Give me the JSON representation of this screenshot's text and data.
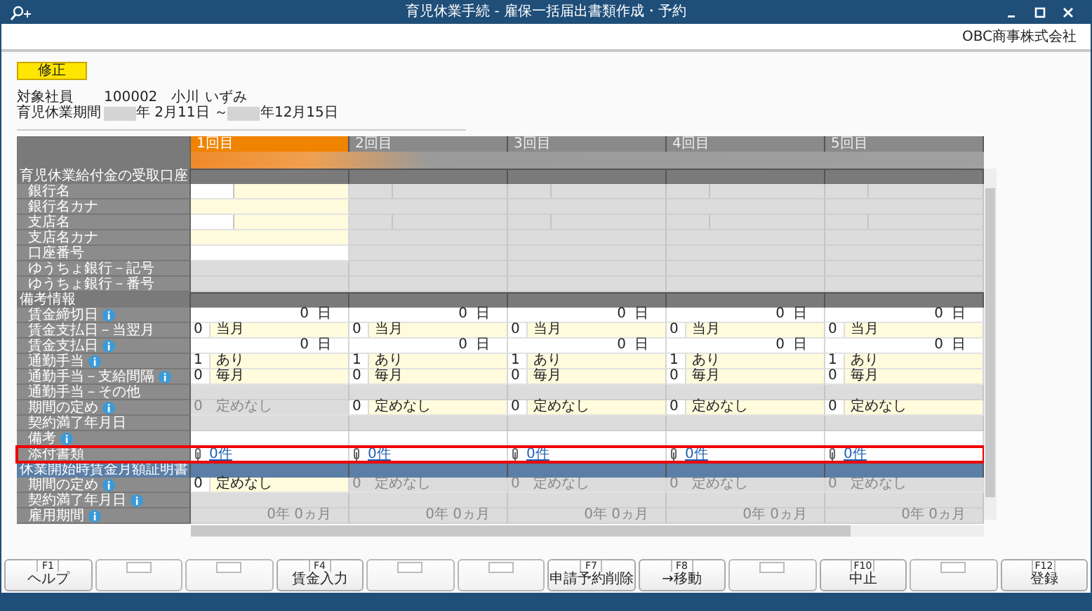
{
  "window": {
    "title": "育児休業手続 - 雇保一括届出書類作成・予約",
    "company": "OBC商事株式会社"
  },
  "mode_badge": "修正",
  "employee": {
    "label": "対象社員",
    "code": "100002",
    "family_name": "小川",
    "given_name": "いずみ"
  },
  "leave_period": {
    "label": "育児休業期間",
    "start": "年 2月11日 ～",
    "end": "年12月15日"
  },
  "columns": [
    {
      "label": "1回目",
      "selected": true
    },
    {
      "label": "2回目",
      "selected": false
    },
    {
      "label": "3回目",
      "selected": false
    },
    {
      "label": "4回目",
      "selected": false
    },
    {
      "label": "5回目",
      "selected": false
    }
  ],
  "rows": [
    {
      "kind": "section",
      "label": "育児休業給付金の受取口座",
      "color": "#7a7a7a"
    },
    {
      "kind": "field",
      "label": "銀行名",
      "info": false,
      "highlighted": false,
      "cells": [
        {
          "kind": "split",
          "locked": false
        },
        {
          "kind": "split",
          "locked": true
        },
        {
          "kind": "split",
          "locked": true
        },
        {
          "kind": "split",
          "locked": true
        },
        {
          "kind": "split",
          "locked": true
        }
      ]
    },
    {
      "kind": "field",
      "label": "銀行名カナ",
      "info": false,
      "highlighted": false,
      "cells": [
        {
          "kind": "blank",
          "locked": false,
          "selectable": true
        },
        {
          "kind": "blank",
          "locked": true,
          "selectable": false
        },
        {
          "kind": "blank",
          "locked": true,
          "selectable": false
        },
        {
          "kind": "blank",
          "locked": true,
          "selectable": false
        },
        {
          "kind": "blank",
          "locked": true,
          "selectable": false
        }
      ]
    },
    {
      "kind": "field",
      "label": "支店名",
      "info": false,
      "highlighted": false,
      "cells": [
        {
          "kind": "split",
          "locked": false
        },
        {
          "kind": "split",
          "locked": true
        },
        {
          "kind": "split",
          "locked": true
        },
        {
          "kind": "split",
          "locked": true
        },
        {
          "kind": "split",
          "locked": true
        }
      ]
    },
    {
      "kind": "field",
      "label": "支店名カナ",
      "info": false,
      "highlighted": false,
      "cells": [
        {
          "kind": "blank",
          "locked": false,
          "selectable": true
        },
        {
          "kind": "blank",
          "locked": true,
          "selectable": false
        },
        {
          "kind": "blank",
          "locked": true,
          "selectable": false
        },
        {
          "kind": "blank",
          "locked": true,
          "selectable": false
        },
        {
          "kind": "blank",
          "locked": true,
          "selectable": false
        }
      ]
    },
    {
      "kind": "field",
      "label": "口座番号",
      "info": false,
      "highlighted": false,
      "cells": [
        {
          "kind": "blank",
          "locked": false,
          "selectable": false
        },
        {
          "kind": "blank",
          "locked": true,
          "selectable": false
        },
        {
          "kind": "blank",
          "locked": true,
          "selectable": false
        },
        {
          "kind": "blank",
          "locked": true,
          "selectable": false
        },
        {
          "kind": "blank",
          "locked": true,
          "selectable": false
        }
      ]
    },
    {
      "kind": "field",
      "label": "ゆうちょ銀行－記号",
      "info": false,
      "highlighted": false,
      "cells": [
        {
          "kind": "blank",
          "locked": true,
          "selectable": false
        },
        {
          "kind": "blank",
          "locked": true,
          "selectable": false
        },
        {
          "kind": "blank",
          "locked": true,
          "selectable": false
        },
        {
          "kind": "blank",
          "locked": true,
          "selectable": false
        },
        {
          "kind": "blank",
          "locked": true,
          "selectable": false
        }
      ]
    },
    {
      "kind": "field",
      "label": "ゆうちょ銀行－番号",
      "info": false,
      "highlighted": false,
      "cells": [
        {
          "kind": "blank",
          "locked": true,
          "selectable": false
        },
        {
          "kind": "blank",
          "locked": true,
          "selectable": false
        },
        {
          "kind": "blank",
          "locked": true,
          "selectable": false
        },
        {
          "kind": "blank",
          "locked": true,
          "selectable": false
        },
        {
          "kind": "blank",
          "locked": true,
          "selectable": false
        }
      ]
    },
    {
      "kind": "section",
      "label": "備考情報",
      "color": "#7a7a7a"
    },
    {
      "kind": "field",
      "label": "賃金締切日",
      "info": true,
      "highlighted": false,
      "cells": [
        {
          "kind": "amount",
          "value": "0",
          "unit": "日"
        },
        {
          "kind": "amount",
          "value": "0",
          "unit": "日"
        },
        {
          "kind": "amount",
          "value": "0",
          "unit": "日"
        },
        {
          "kind": "amount",
          "value": "0",
          "unit": "日"
        },
        {
          "kind": "amount",
          "value": "0",
          "unit": "日"
        }
      ]
    },
    {
      "kind": "field",
      "label": "賃金支払日－当翌月",
      "info": false,
      "highlighted": false,
      "cells": [
        {
          "kind": "code",
          "locked": false,
          "code": "0",
          "text": "当月"
        },
        {
          "kind": "code",
          "locked": false,
          "code": "0",
          "text": "当月"
        },
        {
          "kind": "code",
          "locked": false,
          "code": "0",
          "text": "当月"
        },
        {
          "kind": "code",
          "locked": false,
          "code": "0",
          "text": "当月"
        },
        {
          "kind": "code",
          "locked": false,
          "code": "0",
          "text": "当月"
        }
      ]
    },
    {
      "kind": "field",
      "label": "賃金支払日",
      "info": true,
      "highlighted": false,
      "cells": [
        {
          "kind": "amount",
          "value": "0",
          "unit": "日"
        },
        {
          "kind": "amount",
          "value": "0",
          "unit": "日"
        },
        {
          "kind": "amount",
          "value": "0",
          "unit": "日"
        },
        {
          "kind": "amount",
          "value": "0",
          "unit": "日"
        },
        {
          "kind": "amount",
          "value": "0",
          "unit": "日"
        }
      ]
    },
    {
      "kind": "field",
      "label": "通勤手当",
      "info": true,
      "highlighted": false,
      "cells": [
        {
          "kind": "code",
          "locked": false,
          "code": "1",
          "text": "あり"
        },
        {
          "kind": "code",
          "locked": false,
          "code": "1",
          "text": "あり"
        },
        {
          "kind": "code",
          "locked": false,
          "code": "1",
          "text": "あり"
        },
        {
          "kind": "code",
          "locked": false,
          "code": "1",
          "text": "あり"
        },
        {
          "kind": "code",
          "locked": false,
          "code": "1",
          "text": "あり"
        }
      ]
    },
    {
      "kind": "field",
      "label": "通勤手当－支給間隔",
      "info": true,
      "highlighted": false,
      "cells": [
        {
          "kind": "code",
          "locked": false,
          "code": "0",
          "text": "毎月"
        },
        {
          "kind": "code",
          "locked": false,
          "code": "0",
          "text": "毎月"
        },
        {
          "kind": "code",
          "locked": false,
          "code": "0",
          "text": "毎月"
        },
        {
          "kind": "code",
          "locked": false,
          "code": "0",
          "text": "毎月"
        },
        {
          "kind": "code",
          "locked": false,
          "code": "0",
          "text": "毎月"
        }
      ]
    },
    {
      "kind": "field",
      "label": "通勤手当－その他",
      "info": false,
      "highlighted": false,
      "cells": [
        {
          "kind": "blank",
          "locked": true,
          "selectable": false
        },
        {
          "kind": "blank",
          "locked": true,
          "selectable": false
        },
        {
          "kind": "blank",
          "locked": true,
          "selectable": false
        },
        {
          "kind": "blank",
          "locked": true,
          "selectable": false
        },
        {
          "kind": "blank",
          "locked": true,
          "selectable": false
        }
      ]
    },
    {
      "kind": "field",
      "label": "期間の定め",
      "info": true,
      "highlighted": false,
      "cells": [
        {
          "kind": "code",
          "locked": true,
          "code": "0",
          "text": "定めなし"
        },
        {
          "kind": "code",
          "locked": false,
          "code": "0",
          "text": "定めなし"
        },
        {
          "kind": "code",
          "locked": false,
          "code": "0",
          "text": "定めなし"
        },
        {
          "kind": "code",
          "locked": false,
          "code": "0",
          "text": "定めなし"
        },
        {
          "kind": "code",
          "locked": false,
          "code": "0",
          "text": "定めなし"
        }
      ]
    },
    {
      "kind": "field",
      "label": "契約満了年月日",
      "info": false,
      "highlighted": false,
      "cells": [
        {
          "kind": "blank",
          "locked": true,
          "selectable": false
        },
        {
          "kind": "blank",
          "locked": true,
          "selectable": false
        },
        {
          "kind": "blank",
          "locked": true,
          "selectable": false
        },
        {
          "kind": "blank",
          "locked": true,
          "selectable": false
        },
        {
          "kind": "blank",
          "locked": true,
          "selectable": false
        }
      ]
    },
    {
      "kind": "field",
      "label": "備考",
      "info": true,
      "highlighted": false,
      "cells": [
        {
          "kind": "blank",
          "locked": false,
          "selectable": false
        },
        {
          "kind": "blank",
          "locked": false,
          "selectable": false
        },
        {
          "kind": "blank",
          "locked": false,
          "selectable": false
        },
        {
          "kind": "blank",
          "locked": false,
          "selectable": false
        },
        {
          "kind": "blank",
          "locked": false,
          "selectable": false
        }
      ]
    },
    {
      "kind": "field",
      "label": "添付書類",
      "info": false,
      "highlighted": true,
      "cells": [
        {
          "kind": "link",
          "text": "0件"
        },
        {
          "kind": "link",
          "text": "0件"
        },
        {
          "kind": "link",
          "text": "0件"
        },
        {
          "kind": "link",
          "text": "0件"
        },
        {
          "kind": "link",
          "text": "0件"
        }
      ]
    },
    {
      "kind": "section",
      "label": "休業開始時賃金月額証明書",
      "color": "#5b7ea6"
    },
    {
      "kind": "field",
      "label": "期間の定め",
      "info": true,
      "highlighted": false,
      "cells": [
        {
          "kind": "code",
          "locked": false,
          "code": "0",
          "text": "定めなし"
        },
        {
          "kind": "code",
          "locked": true,
          "code": "0",
          "text": "定めなし"
        },
        {
          "kind": "code",
          "locked": true,
          "code": "0",
          "text": "定めなし"
        },
        {
          "kind": "code",
          "locked": true,
          "code": "0",
          "text": "定めなし"
        },
        {
          "kind": "code",
          "locked": true,
          "code": "0",
          "text": "定めなし"
        }
      ]
    },
    {
      "kind": "field",
      "label": "契約満了年月日",
      "info": true,
      "highlighted": false,
      "cells": [
        {
          "kind": "blank",
          "locked": true,
          "selectable": false
        },
        {
          "kind": "blank",
          "locked": true,
          "selectable": false
        },
        {
          "kind": "blank",
          "locked": true,
          "selectable": false
        },
        {
          "kind": "blank",
          "locked": true,
          "selectable": false
        },
        {
          "kind": "blank",
          "locked": true,
          "selectable": false
        }
      ]
    },
    {
      "kind": "field",
      "label": "雇用期間",
      "info": true,
      "highlighted": false,
      "cells": [
        {
          "kind": "period",
          "text": "0年 0ヵ月"
        },
        {
          "kind": "period",
          "text": "0年 0ヵ月"
        },
        {
          "kind": "period",
          "text": "0年 0ヵ月"
        },
        {
          "kind": "period",
          "text": "0年 0ヵ月"
        },
        {
          "kind": "period",
          "text": "0年 0ヵ月"
        }
      ]
    }
  ],
  "function_keys": [
    {
      "assigned": true,
      "key": "F1",
      "label": "ヘルプ"
    },
    {
      "assigned": false
    },
    {
      "assigned": false
    },
    {
      "assigned": true,
      "key": "F4",
      "label": "賃金入力"
    },
    {
      "assigned": false
    },
    {
      "assigned": false
    },
    {
      "assigned": true,
      "key": "F7",
      "label": "申請予約削除"
    },
    {
      "assigned": true,
      "key": "F8",
      "label": "→移動"
    },
    {
      "assigned": false
    },
    {
      "assigned": true,
      "key": "F10",
      "label": "中止"
    },
    {
      "assigned": false
    },
    {
      "assigned": true,
      "key": "F12",
      "label": "登録"
    }
  ]
}
